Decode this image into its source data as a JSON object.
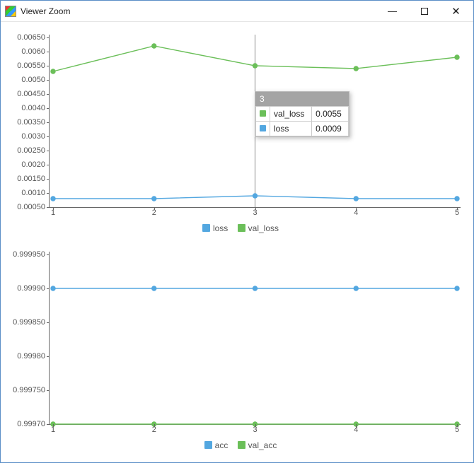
{
  "window": {
    "title": "Viewer Zoom"
  },
  "colors": {
    "blue": "#53a7e0",
    "green": "#6bbf59"
  },
  "tooltip": {
    "header": "3",
    "rows": [
      {
        "color": "green",
        "name": "val_loss",
        "value": "0.0055"
      },
      {
        "color": "blue",
        "name": "loss",
        "value": "0.0009"
      }
    ]
  },
  "legend_top": {
    "items": [
      {
        "color": "blue",
        "label": "loss"
      },
      {
        "color": "green",
        "label": "val_loss"
      }
    ]
  },
  "legend_bot": {
    "items": [
      {
        "color": "blue",
        "label": "acc"
      },
      {
        "color": "green",
        "label": "val_acc"
      }
    ]
  },
  "yticks_top": [
    "0.00050",
    "0.0010",
    "0.00150",
    "0.0020",
    "0.00250",
    "0.0030",
    "0.00350",
    "0.0040",
    "0.00450",
    "0.0050",
    "0.00550",
    "0.0060",
    "0.00650"
  ],
  "yticks_bot": [
    "0.99970",
    "0.999750",
    "0.99980",
    "0.999850",
    "0.99990",
    "0.999950"
  ],
  "xticks": [
    "1",
    "2",
    "3",
    "4",
    "5"
  ],
  "chart_data": [
    {
      "type": "line",
      "title": "",
      "xlabel": "",
      "ylabel": "",
      "x": [
        1,
        2,
        3,
        4,
        5
      ],
      "ylim": [
        0.0005,
        0.0065
      ],
      "cursor_x": 3,
      "series": [
        {
          "name": "loss",
          "color": "blue",
          "values": [
            0.0008,
            0.0008,
            0.0009,
            0.0008,
            0.0008
          ]
        },
        {
          "name": "val_loss",
          "color": "green",
          "values": [
            0.0053,
            0.0062,
            0.0055,
            0.0054,
            0.0058
          ]
        }
      ],
      "legend_position": "bottom"
    },
    {
      "type": "line",
      "title": "",
      "xlabel": "",
      "ylabel": "",
      "x": [
        1,
        2,
        3,
        4,
        5
      ],
      "ylim": [
        0.9997,
        0.99995
      ],
      "series": [
        {
          "name": "acc",
          "color": "blue",
          "values": [
            0.9999,
            0.9999,
            0.9999,
            0.9999,
            0.9999
          ]
        },
        {
          "name": "val_acc",
          "color": "green",
          "values": [
            0.9997,
            0.9997,
            0.9997,
            0.9997,
            0.9997
          ]
        }
      ],
      "legend_position": "bottom"
    }
  ]
}
